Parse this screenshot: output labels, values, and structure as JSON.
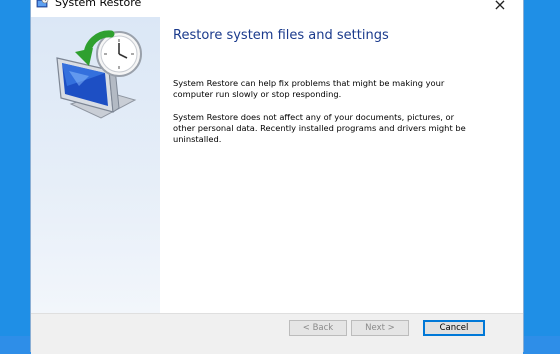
{
  "window": {
    "title": "System Restore",
    "close_glyph": "×"
  },
  "main": {
    "heading": "Restore system files and settings",
    "paragraph1": "System Restore can help fix problems that might be making your computer run slowly or stop responding.",
    "paragraph2": "System Restore does not affect any of your documents, pictures, or other personal data. Recently installed programs and drivers might be uninstalled."
  },
  "footer": {
    "back_label": "< Back",
    "next_label": "Next >",
    "cancel_label": "Cancel"
  },
  "icons": {
    "title_icon": "system-restore-icon",
    "hero_icon": "monitor-clock-restore-icon"
  },
  "colors": {
    "desktop": "#1f8fe6",
    "heading": "#1a3a8c",
    "side_panel": "#dbe7f6",
    "focus_border": "#0078d7"
  }
}
